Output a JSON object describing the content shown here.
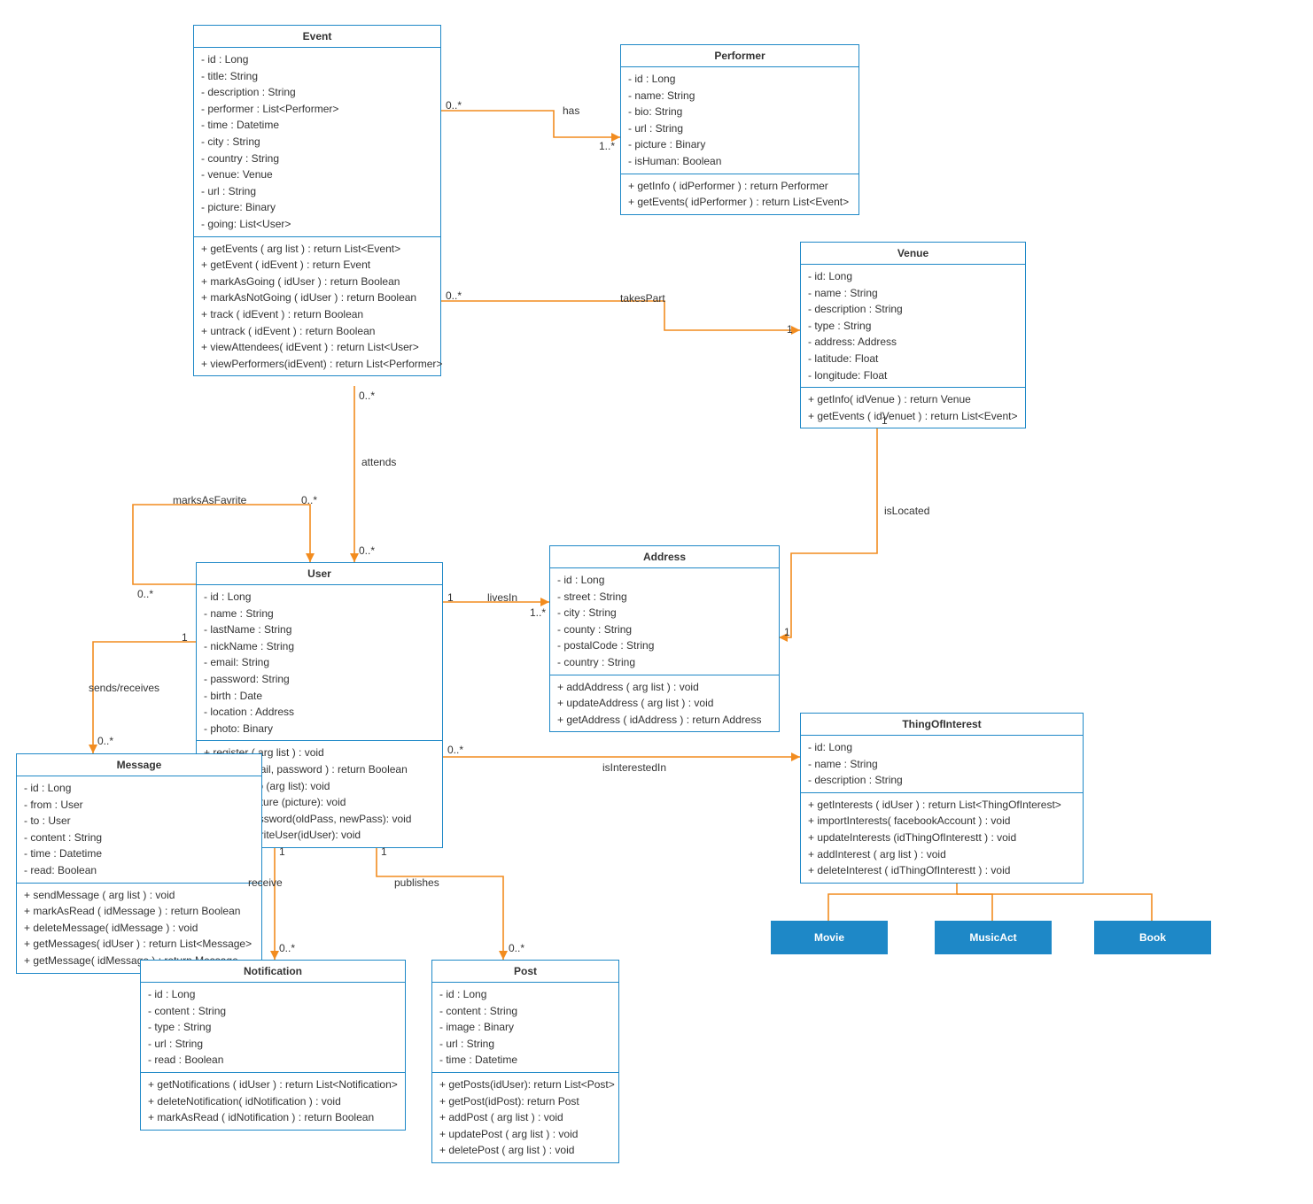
{
  "classes": {
    "event": {
      "title": "Event",
      "attrs": [
        "- id : Long",
        "- title: String",
        "- description : String",
        "- performer : List<Performer>",
        "- time : Datetime",
        "- city : String",
        "- country : String",
        "- venue: Venue",
        "- url : String",
        "- picture: Binary",
        "- going: List<User>"
      ],
      "ops": [
        "+ getEvents ( arg list ) : return List<Event>",
        "+ getEvent ( idEvent ) : return Event",
        "+ markAsGoing ( idUser ) : return Boolean",
        "+ markAsNotGoing ( idUser ) : return Boolean",
        "+ track ( idEvent ) : return Boolean",
        "+ untrack ( idEvent ) : return Boolean",
        "+ viewAttendees( idEvent ) : return List<User>",
        "+ viewPerformers(idEvent) : return List<Performer>"
      ]
    },
    "performer": {
      "title": "Performer",
      "attrs": [
        "- id : Long",
        "- name: String",
        "- bio: String",
        "- url : String",
        "- picture : Binary",
        "- isHuman: Boolean"
      ],
      "ops": [
        "+ getInfo ( idPerformer ) : return Performer",
        "+ getEvents( idPerformer ) : return List<Event>"
      ]
    },
    "venue": {
      "title": "Venue",
      "attrs": [
        "- id: Long",
        "- name : String",
        "- description : String",
        "- type : String",
        "- address: Address",
        "- latitude: Float",
        "- longitude: Float"
      ],
      "ops": [
        "+ getInfo( idVenue ) : return Venue",
        "+ getEvents ( idVenuet ) : return List<Event>"
      ]
    },
    "user": {
      "title": "User",
      "attrs": [
        "- id : Long",
        "- name : String",
        "- lastName : String",
        "- nickName : String",
        "- email: String",
        "- password: String",
        "- birth : Date",
        "- location : Address",
        "- photo: Binary"
      ],
      "ops": [
        "+ register ( arg list ) : void",
        "+ logIn ( email, password ) : return Boolean",
        "+ updateInfo (arg list): void",
        "+ updatePicture (picture): void",
        "+ updatePassword(oldPass, newPass): void",
        "+ markFavoriteUser(idUser): void"
      ]
    },
    "address": {
      "title": "Address",
      "attrs": [
        "- id : Long",
        "- street : String",
        "- city : String",
        "- county : String",
        "- postalCode : String",
        "- country : String"
      ],
      "ops": [
        "+ addAddress ( arg list ) : void",
        "+ updateAddress ( arg list ) : void",
        "+ getAddress ( idAddress ) : return Address"
      ]
    },
    "thing": {
      "title": "ThingOfInterest",
      "attrs": [
        "- id: Long",
        "- name : String",
        "- description : String"
      ],
      "ops": [
        "+ getInterests ( idUser ) : return List<ThingOfInterest>",
        "+ importInterests( facebookAccount ) : void",
        "+ updateInterests (idThingOfInterestt ) : void",
        "+ addInterest ( arg list ) : void",
        "+ deleteInterest ( idThingOfInterestt ) : void"
      ]
    },
    "message": {
      "title": "Message",
      "attrs": [
        "- id : Long",
        "- from : User",
        "- to : User",
        "- content : String",
        "- time : Datetime",
        "- read: Boolean"
      ],
      "ops": [
        "+ sendMessage ( arg list ) : void",
        "+ markAsRead ( idMessage ) : return Boolean",
        "+ deleteMessage( idMessage ) : void",
        "+ getMessages( idUser ) : return List<Message>",
        "+ getMessage( idMessage ) : return Message"
      ]
    },
    "notification": {
      "title": "Notification",
      "attrs": [
        "- id : Long",
        "- content : String",
        "- type : String",
        "- url : String",
        "- read : Boolean"
      ],
      "ops": [
        "+ getNotifications ( idUser ) : return List<Notification>",
        "+ deleteNotification( idNotification ) : void",
        "+ markAsRead ( idNotification ) : return Boolean"
      ]
    },
    "post": {
      "title": "Post",
      "attrs": [
        "- id : Long",
        "- content : String",
        "- image : Binary",
        "- url : String",
        "- time : Datetime"
      ],
      "ops": [
        "+ getPosts(idUser): return List<Post>",
        "+ getPost(idPost): return Post",
        "+ addPost ( arg list ) : void",
        "+ updatePost ( arg list ) : void",
        "+ deletePost ( arg list ) : void"
      ]
    }
  },
  "subs": {
    "movie": "Movie",
    "music": "MusicAct",
    "book": "Book"
  },
  "rels": {
    "has": "has",
    "takesPart": "takesPart",
    "attends": "attends",
    "marksFav": "marksAsFavrite",
    "sendsRec": "sends/receives",
    "livesIn": "livesIn",
    "isLocated": "isLocated",
    "isInterested": "isInterestedIn",
    "receive": "receive",
    "publishes": "publishes"
  },
  "mult": {
    "m0s": "0..*",
    "m1": "1",
    "m1s": "1..*"
  }
}
